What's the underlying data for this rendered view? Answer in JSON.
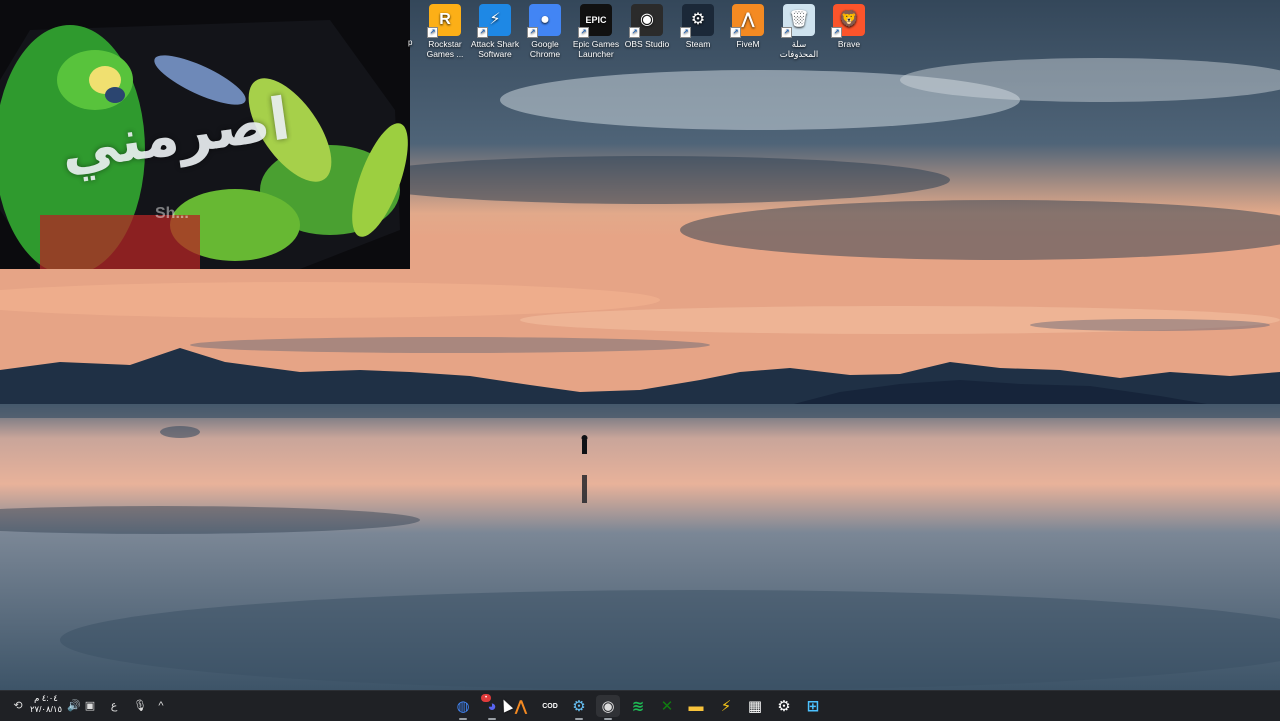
{
  "wallpaper": {
    "description_colors": {
      "sky_top": "#3f5366",
      "clouds": "#c9d3da",
      "horizon": "#f2b48e",
      "mountains": "#1e2e42",
      "water": "#4c6176"
    }
  },
  "overlay": {
    "arabic_text": "اصرمني",
    "subtext": "Sh..."
  },
  "desktop_edge_label": "p",
  "desktop_icons": [
    {
      "label": "Rockstar Games ...",
      "icon": "rockstar-icon",
      "color": "#fcaf17",
      "glyph": "R"
    },
    {
      "label": "Attack Shark Software",
      "icon": "attack-shark-icon",
      "color": "#1e88e5",
      "glyph": "⚡"
    },
    {
      "label": "Google Chrome",
      "icon": "chrome-icon",
      "color": "#4285f4",
      "glyph": "●"
    },
    {
      "label": "Epic Games Launcher",
      "icon": "epic-games-icon",
      "color": "#111111",
      "glyph": "EPIC"
    },
    {
      "label": "OBS Studio",
      "icon": "obs-icon",
      "color": "#2b2b2b",
      "glyph": "◉"
    },
    {
      "label": "Steam",
      "icon": "steam-icon",
      "color": "#1b2838",
      "glyph": "⚙"
    },
    {
      "label": "FiveM",
      "icon": "fivem-icon",
      "color": "#f48a22",
      "glyph": "⋀"
    },
    {
      "label": "سلة المحذوفات",
      "icon": "recycle-bin-icon",
      "color": "#cfe3ef",
      "glyph": "🗑"
    },
    {
      "label": "Brave",
      "icon": "brave-icon",
      "color": "#fb542b",
      "glyph": "🦁"
    }
  ],
  "taskbar": {
    "clock_time": "٤:٠٤ م",
    "clock_date": "٢٧/٠٨/١٥",
    "tray_icons": [
      {
        "name": "network-settings-icon",
        "glyph": "⟲"
      },
      {
        "name": "volume-icon",
        "glyph": "🔊"
      },
      {
        "name": "display-icon",
        "glyph": "▣"
      },
      {
        "name": "language-icon",
        "glyph": "ع"
      },
      {
        "name": "microphone-icon",
        "glyph": "🎙"
      },
      {
        "name": "show-hidden-icons-chevron",
        "glyph": "^"
      }
    ],
    "apps": [
      {
        "name": "chrome-taskbar-icon",
        "glyph": "◍",
        "color": "#4285f4",
        "running": true
      },
      {
        "name": "discord-taskbar-icon",
        "glyph": "◕",
        "color": "#5865f2",
        "running": true,
        "badge": "•"
      },
      {
        "name": "fivem-taskbar-icon",
        "glyph": "⋀",
        "color": "#f48a22",
        "running": false
      },
      {
        "name": "call-of-duty-taskbar-icon",
        "glyph": "COD",
        "color": "#ffffff",
        "running": false
      },
      {
        "name": "steam-taskbar-icon",
        "glyph": "⚙",
        "color": "#66c0f4",
        "running": true
      },
      {
        "name": "obs-taskbar-icon",
        "glyph": "◉",
        "color": "#dddddd",
        "running": true,
        "active": true
      },
      {
        "name": "spotify-taskbar-icon",
        "glyph": "≋",
        "color": "#1db954",
        "running": false
      },
      {
        "name": "xbox-taskbar-icon",
        "glyph": "✕",
        "color": "#107c10",
        "running": false
      },
      {
        "name": "file-explorer-taskbar-icon",
        "glyph": "▬",
        "color": "#f8c33b",
        "running": false
      },
      {
        "name": "attack-shark-taskbar-icon",
        "glyph": "⚡",
        "color": "#f5c518",
        "running": false
      },
      {
        "name": "microsoft-store-taskbar-icon",
        "glyph": "▦",
        "color": "#ffffff",
        "running": false
      },
      {
        "name": "settings-taskbar-icon",
        "glyph": "⚙",
        "color": "#ffffff",
        "running": false
      },
      {
        "name": "start-button-icon",
        "glyph": "⊞",
        "color": "#4cc2ff",
        "running": false
      }
    ]
  }
}
